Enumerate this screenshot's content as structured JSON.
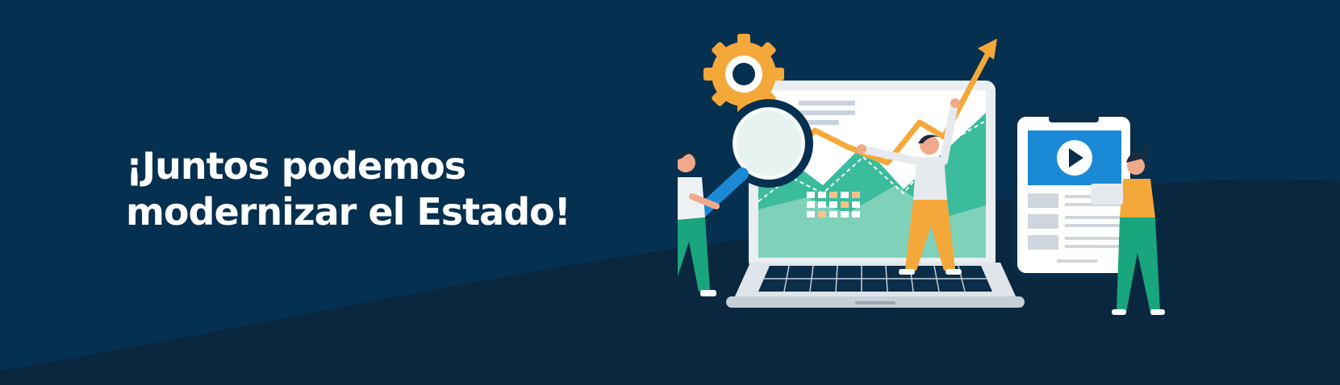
{
  "hero": {
    "headline_line1": "¡Juntos podemos",
    "headline_line2": "modernizar el Estado!"
  },
  "illustration": {
    "icons": [
      "gear-icon",
      "magnifier-icon",
      "growth-arrow-icon",
      "play-icon",
      "laptop-icon",
      "tablet-icon"
    ]
  },
  "colors": {
    "background": "#06304f",
    "wave": "#0a2740",
    "accent_orange": "#f5a83a",
    "accent_green": "#19b08c",
    "accent_blue": "#1b8ad6",
    "text": "#ffffff"
  }
}
